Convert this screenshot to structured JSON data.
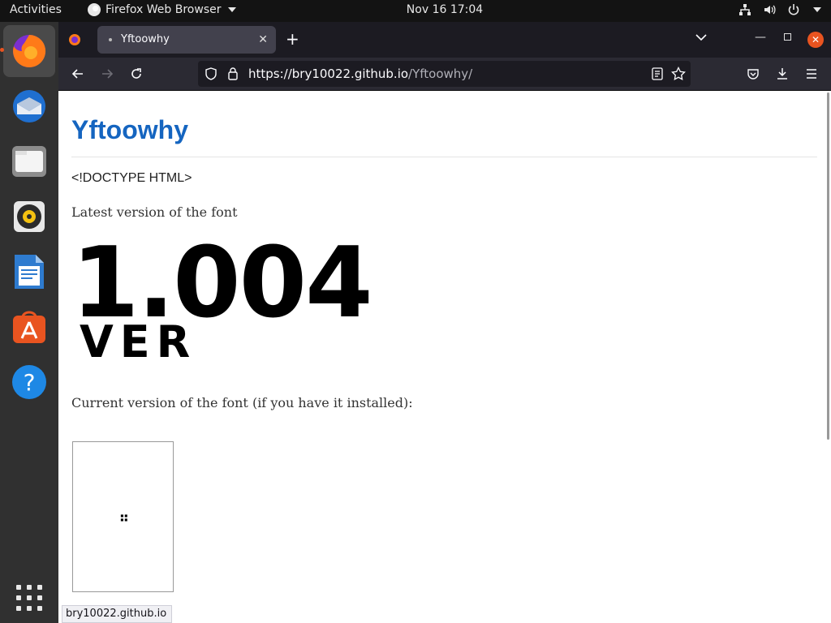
{
  "topbar": {
    "activities": "Activities",
    "app_name": "Firefox Web Browser",
    "clock": "Nov 16  17:04"
  },
  "dock": {
    "items": [
      {
        "name": "firefox",
        "icon": "firefox-icon"
      },
      {
        "name": "thunderbird",
        "icon": "thunderbird-icon"
      },
      {
        "name": "files",
        "icon": "files-icon"
      },
      {
        "name": "rhythmbox",
        "icon": "rhythmbox-icon"
      },
      {
        "name": "writer",
        "icon": "libreoffice-writer-icon"
      },
      {
        "name": "software",
        "icon": "ubuntu-software-icon"
      },
      {
        "name": "help",
        "icon": "help-icon"
      },
      {
        "name": "show-apps",
        "icon": "app-grid-icon"
      }
    ],
    "accent": "#e95420"
  },
  "browser": {
    "tab_title": "Yftoowhy",
    "url_host": "https://bry10022.github.io",
    "url_path": "/Yftoowhy/"
  },
  "page": {
    "heading": "Yftoowhy",
    "doctype": "<!DOCTYPE HTML>",
    "latest_label": "Latest version of the font",
    "big_number": "1.004",
    "big_ver": "VER",
    "current_label": "Current version of the font (if you have it installed):",
    "heading_color": "#1565c0"
  },
  "statusbar": {
    "text": "bry10022.github.io"
  }
}
